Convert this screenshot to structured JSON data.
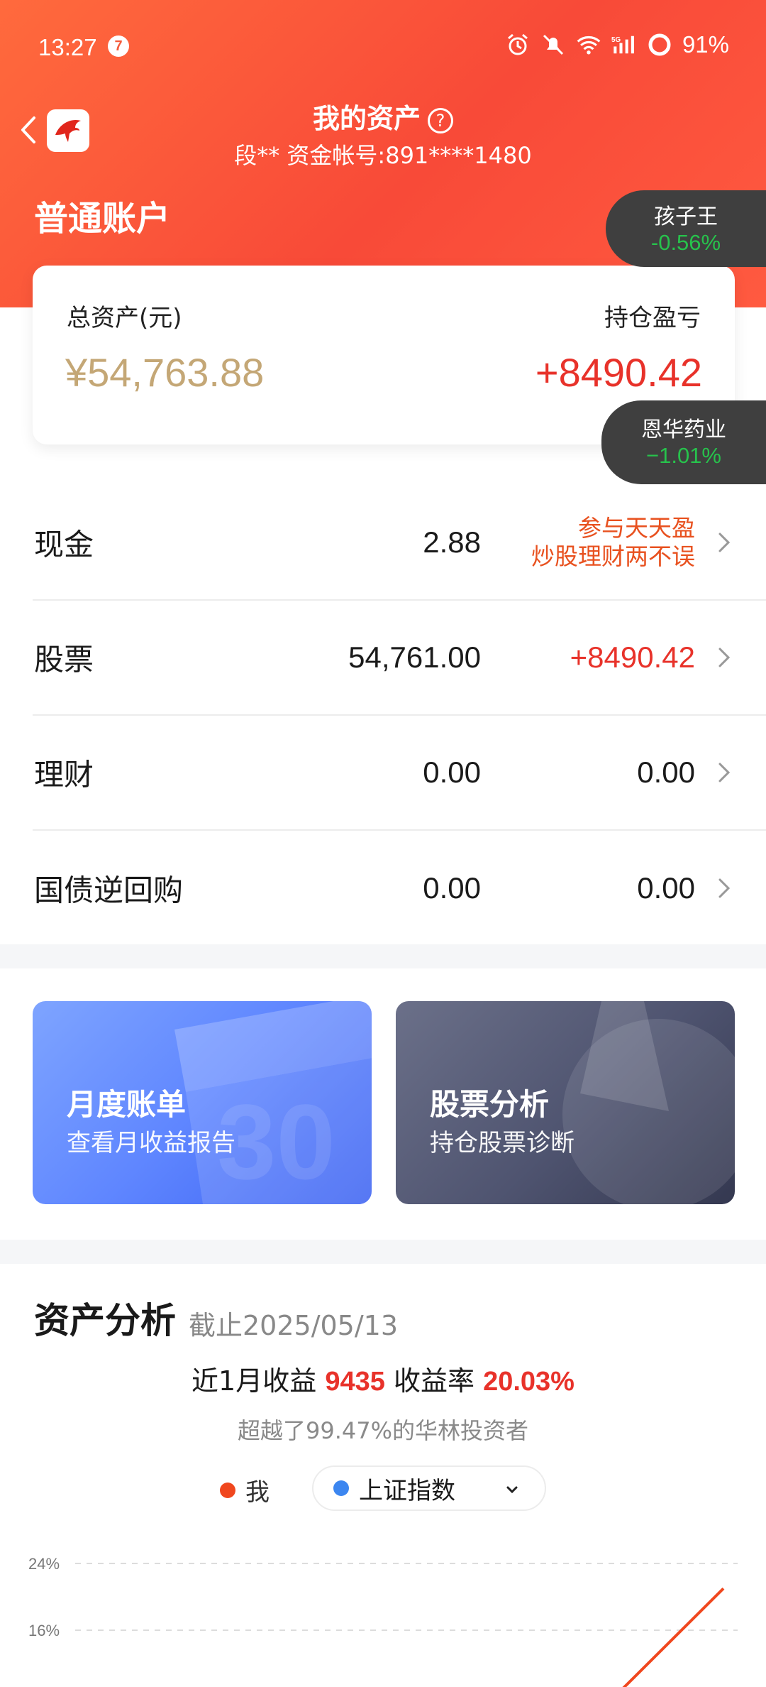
{
  "status_bar": {
    "time": "13:27",
    "notification_count": "7",
    "battery": "91%"
  },
  "header": {
    "title": "我的资产",
    "account_line": "段**  资金帐号:891****1480",
    "account_type": "普通账户"
  },
  "floating_tags": [
    {
      "name": "孩子王",
      "change": "-0.56%"
    },
    {
      "name": "恩华药业",
      "change": "−1.01%"
    }
  ],
  "summary": {
    "total_label": "总资产(元)",
    "total_value": "¥54,763.88",
    "pnl_label": "持仓盈亏",
    "pnl_value": "+8490.42"
  },
  "assets": [
    {
      "name": "现金",
      "amount": "2.88",
      "promo_line1": "参与天天盈",
      "promo_line2": "炒股理财两不误"
    },
    {
      "name": "股票",
      "amount": "54,761.00",
      "extra": "+8490.42"
    },
    {
      "name": "理财",
      "amount": "0.00",
      "extra": "0.00"
    },
    {
      "name": "国债逆回购",
      "amount": "0.00",
      "extra": "0.00"
    }
  ],
  "tiles": {
    "monthly": {
      "title": "月度账单",
      "subtitle": "查看月收益报告",
      "deco_number": "30"
    },
    "analysis": {
      "title": "股票分析",
      "subtitle": "持仓股票诊断"
    }
  },
  "analysis": {
    "title": "资产分析",
    "as_of": "截止2025/05/13",
    "return_label": "近1月收益",
    "return_value": "9435",
    "rate_label": "收益率",
    "rate_value": "20.03%",
    "beat_text": "超越了99.47%的华林投资者",
    "legend_me": "我",
    "benchmark": "上证指数"
  },
  "colors": {
    "me": "#f0471e",
    "benchmark": "#3c86f0",
    "up": "#e8322a",
    "down": "#27c24c"
  },
  "chart_data": {
    "type": "line",
    "y_tick_labels": [
      "24%",
      "16%"
    ],
    "yticks": [
      24,
      16
    ],
    "series": [
      {
        "name": "我",
        "points": [
          [
            0.78,
            4
          ],
          [
            1.0,
            21
          ]
        ]
      }
    ]
  }
}
